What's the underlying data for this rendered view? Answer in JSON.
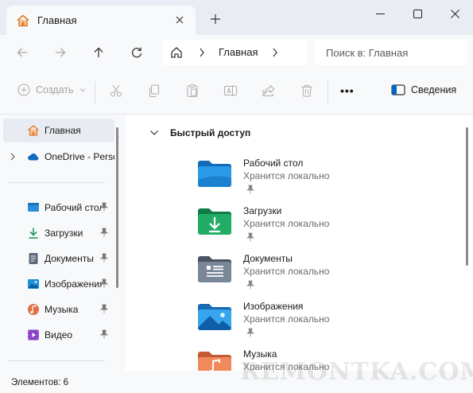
{
  "window": {
    "tab_title": "Главная",
    "tab_icon": "home-icon",
    "colors": {
      "accent": "#0067c0",
      "folder_blue": "#1e90d8",
      "folder_green": "#1e9a5a",
      "folder_gray": "#5e6b7a",
      "music_orange": "#e0704a",
      "video_purple": "#8a3fc4"
    }
  },
  "address": {
    "crumb": "Главная",
    "search_placeholder": "Поиск в: Главная"
  },
  "toolbar": {
    "create_label": "Создать",
    "details_label": "Сведения",
    "more_label": "•••"
  },
  "sidebar": {
    "home": "Главная",
    "onedrive": "OneDrive - Personal",
    "items": [
      {
        "label": "Рабочий стол",
        "icon": "desktop-icon"
      },
      {
        "label": "Загрузки",
        "icon": "download-icon"
      },
      {
        "label": "Документы",
        "icon": "documents-icon"
      },
      {
        "label": "Изображения",
        "icon": "pictures-icon"
      },
      {
        "label": "Музыка",
        "icon": "music-icon"
      },
      {
        "label": "Видео",
        "icon": "video-icon"
      }
    ]
  },
  "main": {
    "section_title": "Быстрый доступ",
    "folders": [
      {
        "name": "Рабочий стол",
        "status": "Хранится локально"
      },
      {
        "name": "Загрузки",
        "status": "Хранится локально"
      },
      {
        "name": "Документы",
        "status": "Хранится локально"
      },
      {
        "name": "Изображения",
        "status": "Хранится локально"
      },
      {
        "name": "Музыка",
        "status": "Хранится локально"
      }
    ]
  },
  "status": {
    "items_count": "Элементов: 6"
  },
  "watermark": "REMONTKA.COM"
}
